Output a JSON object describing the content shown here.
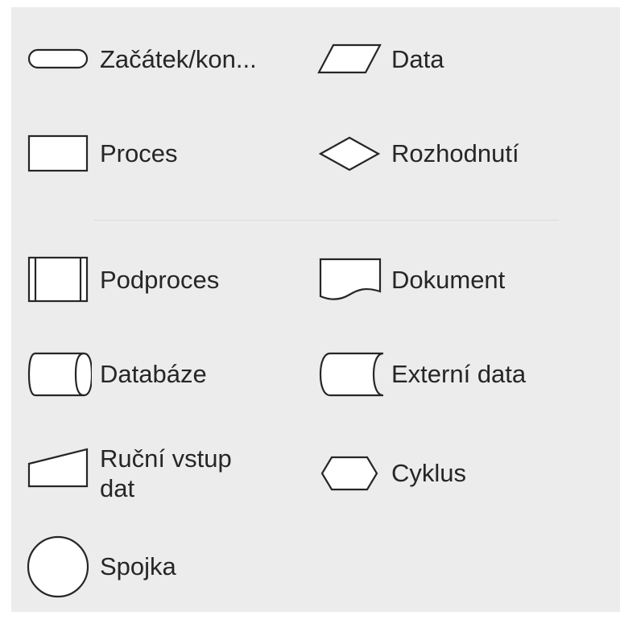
{
  "shapes_panel": {
    "items": [
      {
        "label": "Začátek/kon...",
        "icon": "terminator-icon"
      },
      {
        "label": "Data",
        "icon": "data-parallelogram-icon"
      },
      {
        "label": "Proces",
        "icon": "process-rectangle-icon"
      },
      {
        "label": "Rozhodnutí",
        "icon": "decision-diamond-icon"
      },
      {
        "label": "Podproces",
        "icon": "subprocess-icon"
      },
      {
        "label": "Dokument",
        "icon": "document-icon"
      },
      {
        "label": "Databáze",
        "icon": "database-cylinder-icon"
      },
      {
        "label": "Externí data",
        "icon": "external-data-icon"
      },
      {
        "label": "Ruční vstup dat",
        "icon": "manual-input-icon"
      },
      {
        "label": "Cyklus",
        "icon": "loop-hexagon-icon"
      },
      {
        "label": "Spojka",
        "icon": "connector-circle-icon"
      }
    ]
  }
}
